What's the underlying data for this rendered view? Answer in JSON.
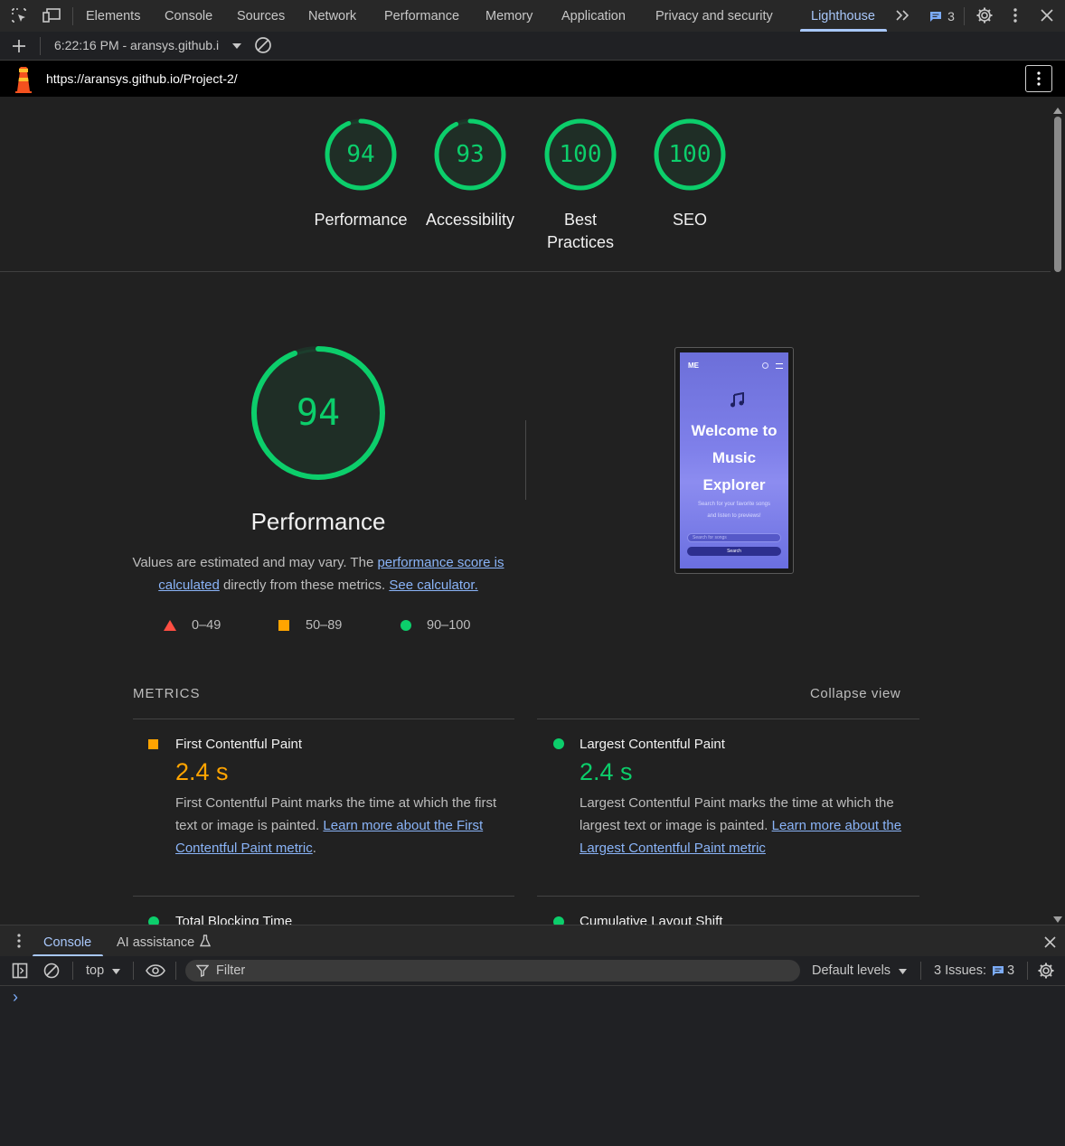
{
  "devtools": {
    "tabs": [
      "Elements",
      "Console",
      "Sources",
      "Network",
      "Performance",
      "Memory",
      "Application",
      "Privacy and security",
      "Lighthouse"
    ],
    "active_tab": "Lighthouse",
    "issues_count": "3"
  },
  "lighthouse_bar": {
    "report_select": "6:22:16 PM - aransys.github.i"
  },
  "url_bar": {
    "url": "https://aransys.github.io/Project-2/"
  },
  "scores": [
    {
      "label": "Performance",
      "score": "94",
      "value": 94
    },
    {
      "label": "Accessibility",
      "score": "93",
      "value": 93
    },
    {
      "label": "Best Practices",
      "score": "100",
      "value": 100
    },
    {
      "label": "SEO",
      "score": "100",
      "value": 100
    }
  ],
  "performance": {
    "score": "94",
    "value": 94,
    "title": "Performance",
    "desc_1": "Values are estimated and may vary. The ",
    "desc_link_1": "performance score is calculated",
    "desc_2": " directly from these metrics. ",
    "desc_link_2": "See calculator.",
    "legend": [
      "0–49",
      "50–89",
      "90–100"
    ]
  },
  "screenshot": {
    "logo": "ME",
    "heading": "Welcome to Music Explorer",
    "heading_lines": [
      "Welcome to",
      "Music",
      "Explorer"
    ],
    "subtitle_lines": [
      "Search for your favorite songs",
      "and listen to previews!"
    ],
    "input_placeholder": "Search for songs",
    "button": "Search"
  },
  "metrics": {
    "header": "METRICS",
    "collapse": "Collapse view",
    "items": [
      {
        "name": "First Contentful Paint",
        "value": "2.4 s",
        "status": "orange",
        "desc": "First Contentful Paint marks the time at which the first text or image is painted. ",
        "link": "Learn more about the First Contentful Paint metric",
        "tail": "."
      },
      {
        "name": "Largest Contentful Paint",
        "value": "2.4 s",
        "status": "green",
        "desc": "Largest Contentful Paint marks the time at which the largest text or image is painted. ",
        "link": "Learn more about the Largest Contentful Paint metric",
        "tail": ""
      },
      {
        "name": "Total Blocking Time",
        "status": "green"
      },
      {
        "name": "Cumulative Layout Shift",
        "status": "green"
      }
    ]
  },
  "drawer": {
    "tabs": [
      "Console",
      "AI assistance"
    ],
    "active_tab": "Console",
    "context": "top",
    "filter_placeholder": "Filter",
    "levels": "Default levels",
    "issues_label": "3 Issues:",
    "issues_count": "3",
    "prompt": "›"
  },
  "colors": {
    "pass": "#0cce6b",
    "average": "#ffa400",
    "fail": "#ff4e42",
    "accent": "#a8c7fa",
    "link": "#8ab4f8"
  }
}
